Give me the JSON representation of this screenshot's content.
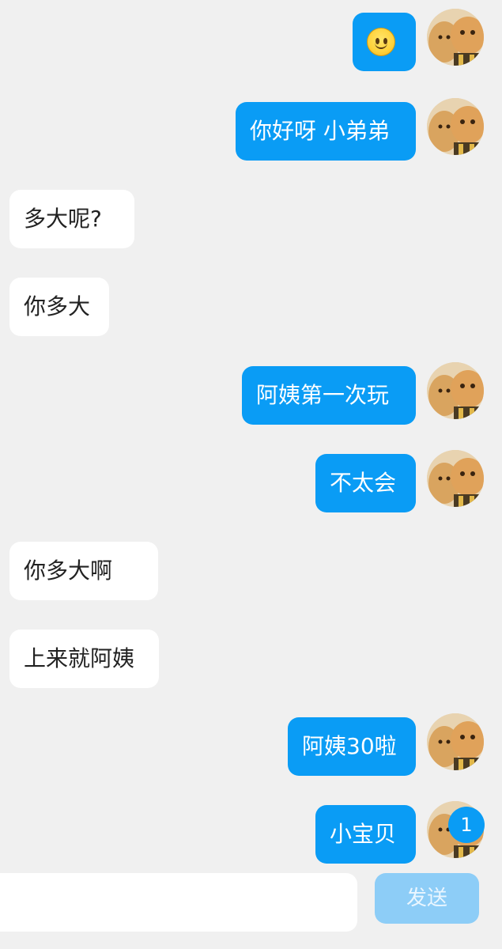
{
  "messages": [
    {
      "side": "out",
      "type": "emoji",
      "icon": "smiley-emoji-icon"
    },
    {
      "side": "out",
      "text": "你好呀 小弟弟"
    },
    {
      "side": "in",
      "text": "多大呢?"
    },
    {
      "side": "in",
      "text": "你多大"
    },
    {
      "side": "out",
      "text": "阿姨第一次玩"
    },
    {
      "side": "out",
      "text": "不太会"
    },
    {
      "side": "in",
      "text": "你多大啊"
    },
    {
      "side": "in",
      "text": "上来就阿姨"
    },
    {
      "side": "out",
      "text": "阿姨30啦"
    },
    {
      "side": "out",
      "text": "小宝贝"
    }
  ],
  "badge": {
    "count": "1"
  },
  "composer": {
    "placeholder": "",
    "send_label": "发送"
  },
  "colors": {
    "outgoing_bubble": "#0a9cf5",
    "incoming_bubble": "#ffffff",
    "background": "#f0f0f0",
    "send_disabled": "#8dcdf7"
  }
}
